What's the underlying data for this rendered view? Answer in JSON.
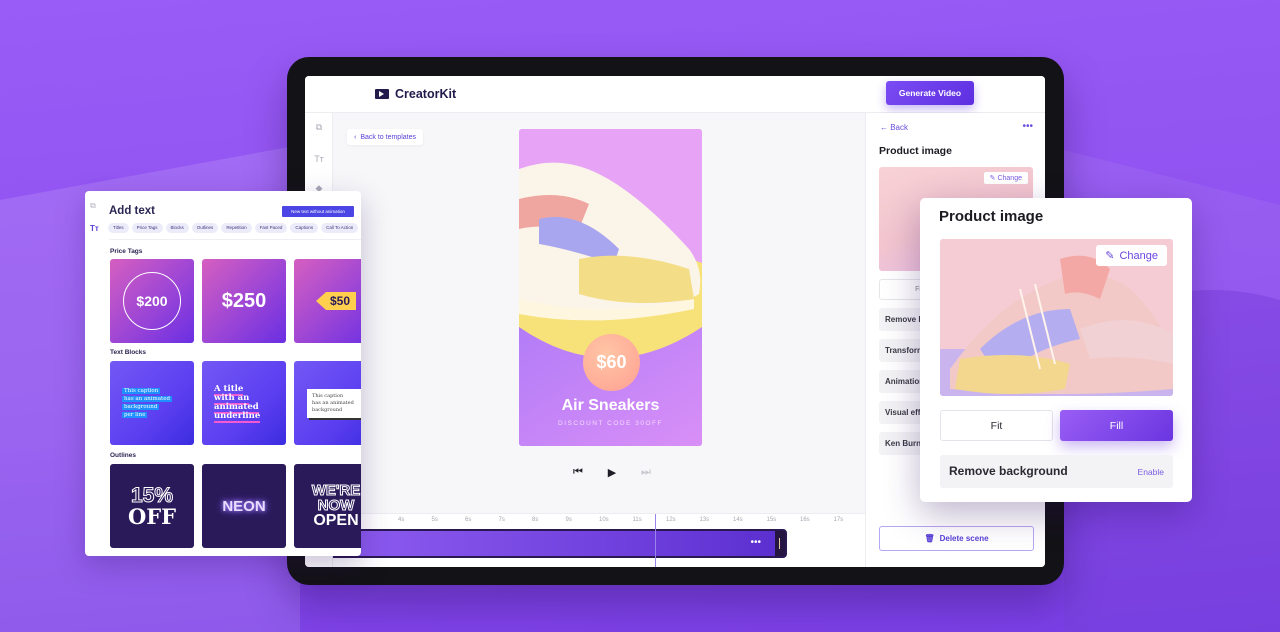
{
  "app": {
    "name": "CreatorKit",
    "generate_button": "Generate Video"
  },
  "editor": {
    "back_to_templates": "Back to templates",
    "rail_icons": [
      "add-media-icon",
      "text-icon",
      "elements-icon"
    ],
    "preview": {
      "price": "$60",
      "title": "Air Sneakers",
      "subtitle": "DISCOUNT CODE 30OFF"
    },
    "playback": {
      "skip_back_icon": "⏮",
      "play_icon": "▶",
      "skip_forward_icon": "⏭"
    },
    "timeline": {
      "ticks": [
        "4s",
        "5s",
        "6s",
        "7s",
        "8s",
        "9s",
        "10s",
        "11s",
        "12s",
        "13s",
        "14s",
        "15s",
        "16s",
        "17s"
      ],
      "clip_menu": "•••"
    }
  },
  "right_panel": {
    "back": "← Back",
    "more": "•••",
    "title": "Product image",
    "change": "Change",
    "fit": "Fit",
    "rows": [
      "Remove background",
      "Transform",
      "Animation",
      "Visual effects",
      "Ken Burns"
    ],
    "delete_scene": "Delete scene"
  },
  "add_text": {
    "title": "Add text",
    "new_text_button": "New text without animation",
    "chips": [
      "Titles",
      "Price Tags",
      "Blocks",
      "Outlines",
      "Repetition",
      "Fast Paced",
      "Captions",
      "Call To Action"
    ],
    "sections": {
      "price_tags": {
        "label": "Price Tags",
        "tiles": [
          "$200",
          "$250",
          "$50"
        ]
      },
      "text_blocks": {
        "label": "Text Blocks",
        "tiles": [
          [
            "This caption",
            "has an animated",
            "background",
            "per line"
          ],
          [
            "A title",
            "with an",
            "animated",
            "underline"
          ],
          [
            "This caption",
            "has an animated",
            "background"
          ]
        ]
      },
      "outlines": {
        "label": "Outlines",
        "tiles": [
          [
            "15%",
            "OFF"
          ],
          [
            "NEON"
          ],
          [
            "WE'RE",
            "NOW",
            "OPEN"
          ]
        ]
      }
    }
  },
  "popover": {
    "title": "Product image",
    "change": "Change",
    "fit": "Fit",
    "fill": "Fill",
    "remove_background": "Remove background",
    "enable": "Enable"
  },
  "colors": {
    "accent": "#6a35e0",
    "background": "#9a5cf6",
    "dark_text": "#221b4b"
  }
}
